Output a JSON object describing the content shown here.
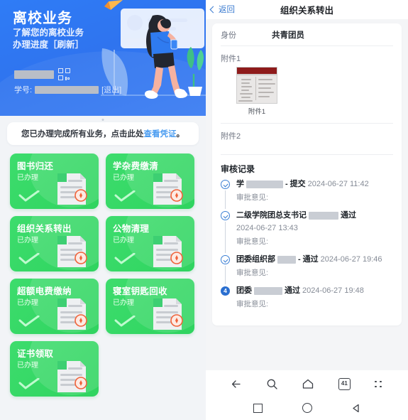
{
  "left": {
    "banner": {
      "title": "离校业务",
      "subtitle_line1": "了解您的离校业务",
      "subtitle_line2": "办理进度［刷新］",
      "student_id_label": "学号:",
      "logout_label": "[退出]",
      "user_name": "",
      "student_id": "",
      "qr_icon": "qr-code-icon",
      "bg_color": "#2f74ef"
    },
    "notice": {
      "text_before": "您已办理完成所有业务，点击此处",
      "link_text": "查看凭证",
      "text_after": "。",
      "link_color": "#4a9cf0"
    },
    "cards_status_label": "已办理",
    "card_color": "#35d865",
    "cards": [
      {
        "title": "图书归还",
        "status": "已办理"
      },
      {
        "title": "学杂费缴清",
        "status": "已办理"
      },
      {
        "title": "组织关系转出",
        "status": "已办理"
      },
      {
        "title": "公物清理",
        "status": "已办理"
      },
      {
        "title": "超额电费缴纳",
        "status": "已办理"
      },
      {
        "title": "寝室钥匙回收",
        "status": "已办理"
      },
      {
        "title": "证书领取",
        "status": "已办理"
      }
    ]
  },
  "right": {
    "header": {
      "back_label": "返回",
      "title": "组织关系转出"
    },
    "identity": {
      "key": "身份",
      "value": "共青团员"
    },
    "attachment1": {
      "label": "附件1",
      "thumb_caption": "附件1"
    },
    "attachment2": {
      "label": "附件2"
    },
    "audit": {
      "title": "审核记录",
      "note_label": "审批意见:",
      "records": [
        {
          "bullet": "check",
          "bullet_text": "",
          "who": "学",
          "who_redacted": true,
          "separator": "-",
          "action": "提交",
          "timestamp": "2024-06-27 11:42",
          "note": "审批意见:"
        },
        {
          "bullet": "check",
          "bullet_text": "",
          "who": "二级学院团总支书记",
          "who_redacted": true,
          "separator": "",
          "action": "通过",
          "timestamp": "2024-06-27 13:43",
          "note": "审批意见:"
        },
        {
          "bullet": "check",
          "bullet_text": "",
          "who": "团委组织部",
          "who_redacted": true,
          "separator": "-",
          "action": "通过",
          "timestamp": "2024-06-27 19:46",
          "note": "审批意见:"
        },
        {
          "bullet": "number",
          "bullet_text": "4",
          "who": "团委",
          "who_redacted": true,
          "separator": "",
          "action": "通过",
          "timestamp": "2024-06-27 19:48",
          "note": "审批意见:"
        }
      ]
    },
    "navbar": {
      "row1": [
        {
          "icon": "back-arrow-icon",
          "label": ""
        },
        {
          "icon": "search-icon",
          "label": ""
        },
        {
          "icon": "home-icon",
          "label": ""
        },
        {
          "icon": "tabs-icon",
          "label": "41"
        },
        {
          "icon": "more-dots-icon",
          "label": ""
        }
      ],
      "row2": [
        {
          "icon": "recents-square-icon"
        },
        {
          "icon": "home-circle-icon"
        },
        {
          "icon": "back-triangle-icon"
        }
      ],
      "tab_count": "41"
    }
  }
}
